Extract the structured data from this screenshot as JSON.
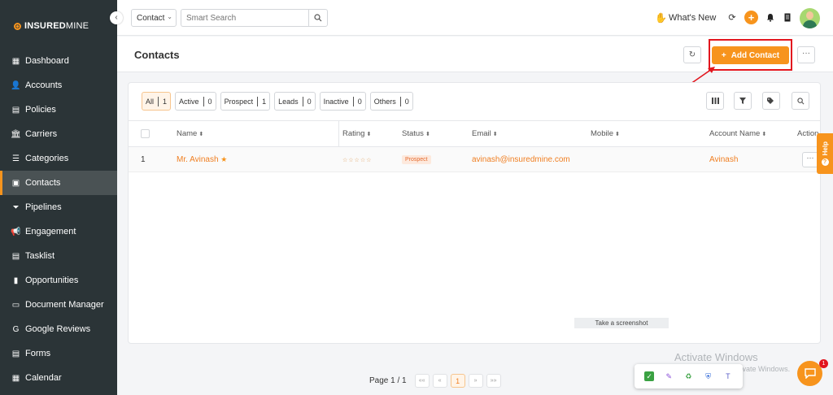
{
  "brand": {
    "name_bold": "INSURED",
    "name_light": "MINE"
  },
  "sidebar": {
    "collapse_glyph": "‹",
    "items": [
      {
        "label": "Dashboard",
        "icon": "dashboard-icon",
        "glyph": "▦"
      },
      {
        "label": "Accounts",
        "icon": "accounts-icon",
        "glyph": "👤"
      },
      {
        "label": "Policies",
        "icon": "policies-icon",
        "glyph": "▤"
      },
      {
        "label": "Carriers",
        "icon": "carriers-icon",
        "glyph": "🏛"
      },
      {
        "label": "Categories",
        "icon": "categories-icon",
        "glyph": "☰"
      },
      {
        "label": "Contacts",
        "icon": "contacts-icon",
        "glyph": "▣",
        "active": true
      },
      {
        "label": "Pipelines",
        "icon": "pipelines-icon",
        "glyph": "⏷"
      },
      {
        "label": "Engagement",
        "icon": "engagement-icon",
        "glyph": "📢"
      },
      {
        "label": "Tasklist",
        "icon": "tasklist-icon",
        "glyph": "▤"
      },
      {
        "label": "Opportunities",
        "icon": "opportunities-icon",
        "glyph": "▮"
      },
      {
        "label": "Document Manager",
        "icon": "document-manager-icon",
        "glyph": "▭"
      },
      {
        "label": "Google Reviews",
        "icon": "google-reviews-icon",
        "glyph": "G"
      },
      {
        "label": "Forms",
        "icon": "forms-icon",
        "glyph": "▤"
      },
      {
        "label": "Calendar",
        "icon": "calendar-icon",
        "glyph": "▦"
      }
    ]
  },
  "topbar": {
    "search_type": "Contact",
    "search_placeholder": "Smart Search",
    "whats_new": "What's New",
    "plus_glyph": "+"
  },
  "page": {
    "title": "Contacts",
    "add_contact_label": "Add Contact",
    "add_glyph": "+",
    "more_glyph": "···",
    "refresh_glyph": "↻"
  },
  "filters": [
    {
      "label": "All",
      "count": "1",
      "active": true
    },
    {
      "label": "Active",
      "count": "0"
    },
    {
      "label": "Prospect",
      "count": "1"
    },
    {
      "label": "Leads",
      "count": "0"
    },
    {
      "label": "Inactive",
      "count": "0"
    },
    {
      "label": "Others",
      "count": "0"
    }
  ],
  "table": {
    "columns": [
      "Name",
      "Rating",
      "Status",
      "Email",
      "Mobile",
      "Account Name",
      "Action"
    ],
    "sort_glyph": "⬍",
    "rows": [
      {
        "index": "1",
        "name": "Mr. Avinash",
        "favorite_glyph": "★",
        "rating": "☆☆☆☆☆",
        "status": "Prospect",
        "email": "avinash@insuredmine.com",
        "mobile": "",
        "account_name": "Avinash",
        "action_glyph": "···"
      }
    ]
  },
  "help": {
    "label": "Help",
    "glyph": "?"
  },
  "screenshot_tip": "Take a screenshot",
  "pagination": {
    "text": "Page 1 / 1",
    "first": "««",
    "prev": "«",
    "current": "1",
    "next": "»",
    "last": "»»"
  },
  "activate_windows": {
    "title": "Activate Windows",
    "subtitle": "Go to Settings to activate Windows."
  },
  "chat": {
    "badge": "1"
  },
  "colors": {
    "accent": "#f7941d",
    "sidebar": "#2b3437",
    "highlight": "#e2161e"
  }
}
